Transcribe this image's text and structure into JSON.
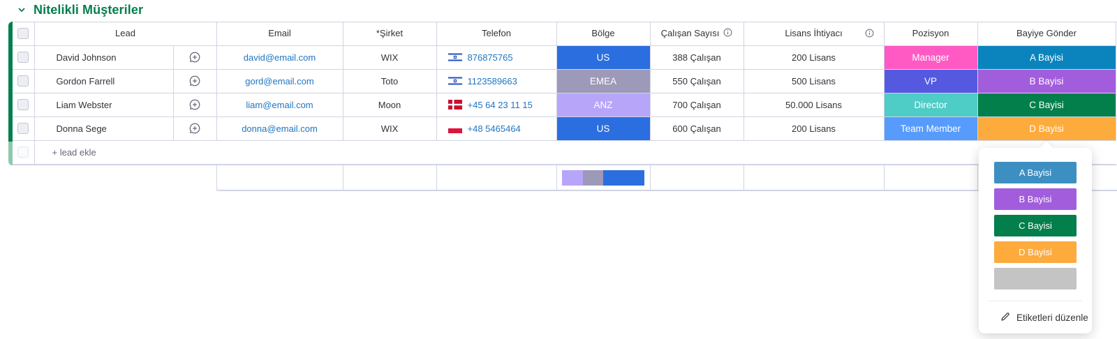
{
  "group": {
    "title": "Nitelikli Müşteriler"
  },
  "columns": {
    "lead": "Lead",
    "email": "Email",
    "company": "*Şirket",
    "phone": "Telefon",
    "region": "Bölge",
    "employees": "Çalışan Sayısı",
    "license": "Lisans İhtiyacı",
    "position": "Pozisyon",
    "dealer": "Bayiye Gönder"
  },
  "rows": [
    {
      "name": "David Johnson",
      "email": "david@email.com",
      "company": "WIX",
      "phone": "876875765",
      "flag": "israel-flag",
      "region": "US",
      "region_color": "#2b6ee0",
      "employees": "388 Çalışan",
      "license": "200 Lisans",
      "position": "Manager",
      "position_color": "#ff5ac4",
      "dealer": "A Bayisi",
      "dealer_color": "#0b84bd"
    },
    {
      "name": "Gordon Farrell",
      "email": "gord@email.com",
      "company": "Toto",
      "phone": "1123589663",
      "flag": "israel-flag",
      "region": "EMEA",
      "region_color": "#9d99b9",
      "employees": "550 Çalışan",
      "license": "500 Lisans",
      "position": "VP",
      "position_color": "#5559df",
      "dealer": "B Bayisi",
      "dealer_color": "#a25ddc"
    },
    {
      "name": "Liam Webster",
      "email": "liam@email.com",
      "company": "Moon",
      "phone": "+45 64 23 11 15",
      "flag": "denmark-flag",
      "region": "ANZ",
      "region_color": "#b7a5f9",
      "employees": "700 Çalışan",
      "license": "50.000 Lisans",
      "position": "Director",
      "position_color": "#4eccc6",
      "dealer": "C Bayisi",
      "dealer_color": "#037f4c"
    },
    {
      "name": "Donna Sege",
      "email": "donna@email.com",
      "company": "WIX",
      "phone": "+48 5465464",
      "flag": "poland-flag",
      "region": "US",
      "region_color": "#2b6ee0",
      "employees": "600 Çalışan",
      "license": "200 Lisans",
      "position": "Team Member",
      "position_color": "#579bfc",
      "dealer": "D Bayisi",
      "dealer_color": "#fdab3d"
    }
  ],
  "add_row_label": "+ lead ekle",
  "region_distribution": [
    {
      "label": "ANZ",
      "share": 0.25,
      "color": "#b7a5f9"
    },
    {
      "label": "EMEA",
      "share": 0.25,
      "color": "#9d99b9"
    },
    {
      "label": "US",
      "share": 0.5,
      "color": "#2b6ee0"
    }
  ],
  "dropdown": {
    "options": [
      {
        "label": "A Bayisi",
        "color": "#3e8fc1"
      },
      {
        "label": "B Bayisi",
        "color": "#a25ddc"
      },
      {
        "label": "C Bayisi",
        "color": "#037f4c"
      },
      {
        "label": "D Bayisi",
        "color": "#fdab3d"
      },
      {
        "label": "",
        "color": "#c4c4c4"
      }
    ],
    "edit_label": "Etiketleri düzenle"
  }
}
